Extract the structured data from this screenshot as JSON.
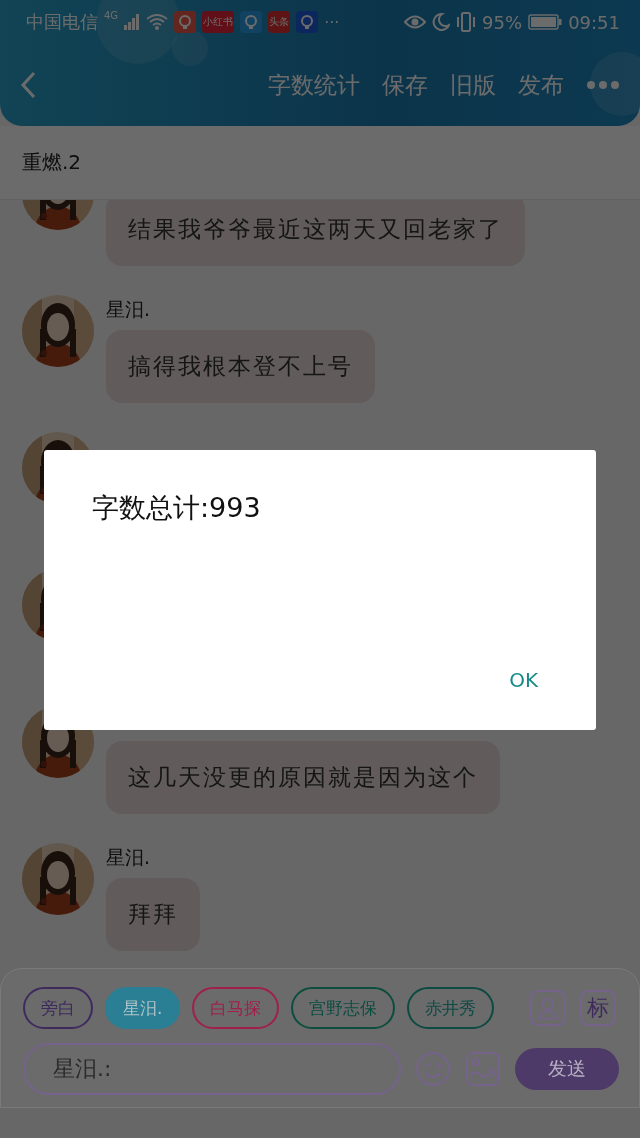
{
  "status_bar": {
    "carrier": "中国电信",
    "network": "4G",
    "more": "···",
    "battery_percent": "95%",
    "time": "09:51",
    "notifications": [
      {
        "kind": "icon"
      },
      {
        "kind": "label",
        "label": "小红书"
      },
      {
        "kind": "icon"
      },
      {
        "kind": "label",
        "label": "头条"
      },
      {
        "kind": "icon"
      }
    ]
  },
  "header": {
    "actions": [
      "字数统计",
      "保存",
      "旧版",
      "发布"
    ]
  },
  "title": "重燃.2",
  "messages": [
    {
      "kind": "message",
      "text": "结果我爷爷最近这两天又回老家了"
    },
    {
      "kind": "message",
      "name": "星汨.",
      "text": "搞得我根本登不上号"
    },
    {
      "kind": "avatar_only"
    },
    {
      "kind": "avatar_only"
    },
    {
      "kind": "message",
      "text": "这几天没更的原因就是因为这个"
    },
    {
      "kind": "message",
      "name": "星汨.",
      "text": "拜拜"
    }
  ],
  "roles": [
    {
      "label": "旁白",
      "color": "#3f2a5e",
      "selected": false
    },
    {
      "label": "星汨.",
      "color": "#2a7f94",
      "selected": true
    },
    {
      "label": "白马探",
      "color": "#a0204a",
      "selected": false
    },
    {
      "label": "宫野志保",
      "color": "#0d4d40",
      "selected": false
    },
    {
      "label": "赤井秀",
      "color": "#0e4a44",
      "selected": false
    }
  ],
  "tag_button": "标",
  "input": {
    "value": "星汨.:"
  },
  "send_button": "发送",
  "dialog": {
    "message": "字数总计:993",
    "ok": "OK"
  }
}
